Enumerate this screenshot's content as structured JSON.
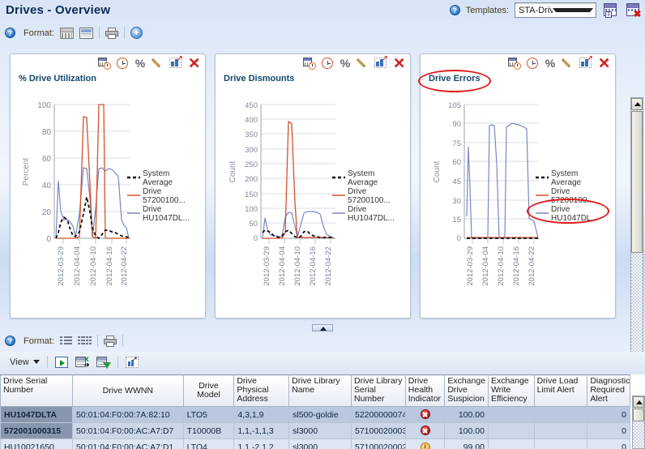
{
  "header": {
    "title": "Drives - Overview",
    "help_icon": "help-icon",
    "templates_label": "Templates:",
    "template_selected": "STA-Drive-Health",
    "save_template_icon": "save-template-icon",
    "delete_template_icon": "delete-template-icon"
  },
  "format_toolbar": {
    "help_icon": "help-icon",
    "label": "Format:",
    "grid_icon": "grid-layout-icon",
    "split_icon": "split-layout-icon",
    "print_icon": "print-icon",
    "add_icon": "add-chart-icon"
  },
  "panel_tools": {
    "date_range_icon": "calendar-clock-icon",
    "time_icon": "clock-icon",
    "percent_icon": "percent-icon",
    "edit_icon": "pencil-edit-icon",
    "detach_icon": "detach-chart-icon",
    "close_icon": "close-icon"
  },
  "lower_format_toolbar": {
    "help_icon": "help-icon",
    "label": "Format:",
    "list_icon": "list-view-icon",
    "detail_list_icon": "detail-list-view-icon",
    "print_icon": "print-icon"
  },
  "view_toolbar": {
    "view_label": "View",
    "query_icon": "run-query-icon",
    "export_excel_icon": "export-excel-icon",
    "filter_icon": "filter-icon",
    "detach_icon": "detach-table-icon"
  },
  "annotations": {
    "circle_title": "Drive Errors",
    "circle_legend": "Drive HU1047DL..."
  },
  "charts": [
    {
      "title": "% Drive Utilization",
      "ylabel": "Percent",
      "yticks": [
        "100",
        "80",
        "60",
        "40",
        "20",
        "0"
      ],
      "xticks": [
        "2012-03-29",
        "2012-04-04",
        "2012-04-10",
        "2012-04-16",
        "2012-04-22"
      ],
      "legend": [
        "System Average",
        "Drive 57200100...",
        "Drive HU1047DL..."
      ]
    },
    {
      "title": "Drive Dismounts",
      "ylabel": "Count",
      "yticks": [
        "450",
        "400",
        "350",
        "300",
        "250",
        "200",
        "150",
        "100",
        "50",
        "0"
      ],
      "xticks": [
        "2012-03-29",
        "2012-04-04",
        "2012-04-10",
        "2012-04-16",
        "2012-04-22"
      ],
      "legend": [
        "System Average",
        "Drive 57200100...",
        "Drive HU1047DL..."
      ]
    },
    {
      "title": "Drive Errors",
      "ylabel": "Count",
      "yticks": [
        "105",
        "90",
        "75",
        "60",
        "45",
        "30",
        "15",
        "0"
      ],
      "xticks": [
        "2012-03-29",
        "2012-04-04",
        "2012-04-10",
        "2012-04-16",
        "2012-04-22"
      ],
      "legend": [
        "System Average",
        "Drive 57200100...",
        "Drive HU1047DL..."
      ]
    }
  ],
  "chart_data": [
    {
      "type": "line",
      "title": "% Drive Utilization",
      "xlabel": "",
      "ylabel": "Percent",
      "ylim": [
        0,
        100
      ],
      "yticks": [
        0,
        20,
        40,
        60,
        80,
        100
      ],
      "x": [
        "2012-03-29",
        "2012-04-04",
        "2012-04-10",
        "2012-04-16",
        "2012-04-22"
      ],
      "grid": true,
      "legend_position": "right",
      "series": [
        {
          "name": "System Average",
          "color": "#111111",
          "style": "dashed",
          "values": [
            0,
            4,
            12,
            16,
            14,
            8,
            2,
            1,
            5,
            18,
            31,
            20,
            8,
            2,
            0,
            3,
            6,
            6,
            5,
            4,
            3,
            2,
            1,
            1,
            0
          ]
        },
        {
          "name": "Drive 57200100...",
          "color": "#d4512a",
          "style": "solid",
          "values": [
            0,
            0,
            0,
            0,
            0,
            0,
            0,
            0,
            1,
            91,
            90,
            40,
            1,
            0,
            100,
            100,
            100,
            0,
            0,
            0,
            0,
            0,
            0,
            0,
            0
          ]
        },
        {
          "name": "Drive HU1047DL...",
          "color": "#7b86c4",
          "style": "solid",
          "values": [
            0,
            43,
            20,
            14,
            14,
            13,
            9,
            1,
            18,
            53,
            52,
            30,
            1,
            22,
            52,
            53,
            50,
            52,
            51,
            49,
            46,
            14,
            10,
            8,
            0
          ]
        }
      ]
    },
    {
      "type": "line",
      "title": "Drive Dismounts",
      "xlabel": "",
      "ylabel": "Count",
      "ylim": [
        0,
        450
      ],
      "yticks": [
        0,
        50,
        100,
        150,
        200,
        250,
        300,
        350,
        400,
        450
      ],
      "x": [
        "2012-03-29",
        "2012-04-04",
        "2012-04-10",
        "2012-04-16",
        "2012-04-22"
      ],
      "grid": true,
      "legend_position": "right",
      "series": [
        {
          "name": "System Average",
          "color": "#111111",
          "style": "dashed",
          "values": [
            20,
            26,
            24,
            20,
            10,
            5,
            4,
            8,
            22,
            26,
            18,
            6,
            3,
            6,
            20,
            22,
            14,
            8,
            5,
            4,
            4,
            4,
            3,
            2,
            2
          ]
        },
        {
          "name": "Drive 57200100...",
          "color": "#d4512a",
          "style": "solid",
          "values": [
            0,
            0,
            0,
            0,
            0,
            0,
            0,
            0,
            20,
            392,
            388,
            120,
            2,
            0,
            2,
            2,
            2,
            2,
            2,
            2,
            2,
            2,
            2,
            2,
            2
          ]
        },
        {
          "name": "Drive HU1047DL...",
          "color": "#7b86c4",
          "style": "solid",
          "values": [
            0,
            68,
            30,
            12,
            8,
            8,
            6,
            6,
            70,
            88,
            86,
            40,
            2,
            44,
            86,
            90,
            91,
            90,
            88,
            85,
            40,
            14,
            10,
            8,
            0
          ]
        }
      ]
    },
    {
      "type": "line",
      "title": "Drive Errors",
      "xlabel": "",
      "ylabel": "Count",
      "ylim": [
        0,
        105
      ],
      "yticks": [
        0,
        15,
        30,
        45,
        60,
        75,
        90,
        105
      ],
      "x": [
        "2012-03-29",
        "2012-04-04",
        "2012-04-10",
        "2012-04-16",
        "2012-04-22"
      ],
      "grid": true,
      "legend_position": "right",
      "series": [
        {
          "name": "System Average",
          "color": "#111111",
          "style": "dashed",
          "values": [
            0,
            0,
            0,
            0,
            0,
            0,
            0,
            0,
            0,
            0,
            0,
            0,
            0,
            0,
            0,
            0,
            0,
            0,
            0,
            0,
            0,
            0,
            0,
            0,
            0
          ]
        },
        {
          "name": "Drive 57200100...",
          "color": "#d4512a",
          "style": "solid",
          "values": [
            0,
            0,
            0,
            0,
            0,
            0,
            0,
            0,
            0,
            0,
            0,
            0,
            0,
            0,
            0,
            0,
            0,
            0,
            0,
            0,
            0,
            0,
            0,
            0,
            0
          ]
        },
        {
          "name": "Drive HU1047DL...",
          "color": "#7b86c4",
          "style": "solid",
          "values": [
            18,
            72,
            40,
            0,
            0,
            0,
            0,
            0,
            88,
            88,
            60,
            0,
            0,
            70,
            87,
            89,
            90,
            88,
            86,
            84,
            20,
            18,
            17,
            6,
            0
          ]
        }
      ]
    }
  ],
  "table": {
    "columns": [
      "Drive Serial Number",
      "Drive WWNN",
      "Drive Model",
      "Drive Physical Address",
      "Drive Library Name",
      "Drive Library Serial Number",
      "Drive Health Indicator",
      "Exchange Drive Suspicion",
      "Exchange Write Efficiency",
      "Drive Load Limit Alert",
      "Diagnostic Required Alert"
    ],
    "rows": [
      {
        "serial": "HU1047DLTA",
        "wwnn": "50:01:04:F0:00:7A:82:10",
        "model": "LTO5",
        "phys": "4,3,1,9",
        "lib_name": "sl500-goldie",
        "lib_serial": "52200000074",
        "health": "error",
        "suspicion": "100.00",
        "write_eff": "",
        "load_limit": "",
        "diag": "0",
        "selected": true
      },
      {
        "serial": "572001000315",
        "wwnn": "50:01:04:F0:00:AC:A7:D7",
        "model": "T10000B",
        "phys": "1,1,-1,1,3",
        "lib_name": "sl3000",
        "lib_serial": "57100020003",
        "health": "error",
        "suspicion": "100.00",
        "write_eff": "",
        "load_limit": "",
        "diag": "0",
        "selected": true
      },
      {
        "serial": "HU10021650",
        "wwnn": "50:01:04:F0:00:AC:A7:D1",
        "model": "LTO4",
        "phys": "1,1,-2,1,2",
        "lib_name": "sl3000",
        "lib_serial": "57100020002",
        "health": "warn",
        "suspicion": "99.00",
        "write_eff": "",
        "load_limit": "",
        "diag": "0",
        "selected": false
      }
    ]
  },
  "colors": {
    "accent": "#13486e",
    "annotation_red": "#e01b1b",
    "series_orange": "#d4512a",
    "series_purple": "#7b86c4",
    "series_black": "#111111",
    "link_blue": "#1b52b5"
  }
}
